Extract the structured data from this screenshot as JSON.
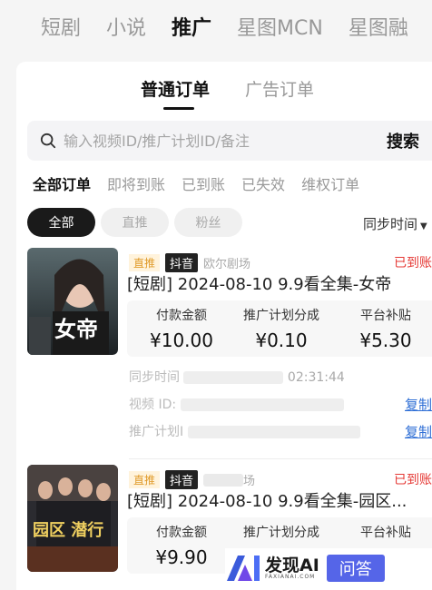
{
  "top_tabs": [
    "短剧",
    "小说",
    "推广",
    "星图MCN",
    "星图融"
  ],
  "top_tab_active": 2,
  "order_type": {
    "tabs": [
      "普通订单",
      "广告订单"
    ],
    "active": 0
  },
  "search": {
    "placeholder": "输入视频ID/推广计划ID/备注",
    "button": "搜索"
  },
  "status_tabs": [
    "全部订单",
    "即将到账",
    "已到账",
    "已失效",
    "维权订单"
  ],
  "status_active": 0,
  "filter_pills": [
    "全部",
    "直推",
    "粉丝"
  ],
  "filter_active": 0,
  "sort_label": "同步时间",
  "orders": [
    {
      "tag_type": "直推",
      "tag_platform": "抖音",
      "source": "欧尔剧场",
      "status": "已到账",
      "title": "[短剧] 2024-08-10 9.9看全集-女帝",
      "stat_labels": [
        "付款金额",
        "推广计划分成",
        "平台补贴"
      ],
      "stat_values": [
        "¥10.00",
        "¥0.10",
        "¥5.30"
      ],
      "sync_label": "同步时间",
      "sync_time_tail": "02:31:44",
      "video_id_label": "视频 ID:",
      "plan_label": "推广计划I",
      "copy_label": "复制",
      "poster_text": "女帝"
    },
    {
      "tag_type": "直推",
      "tag_platform": "抖音",
      "source": "场",
      "status": "已到账",
      "title": "[短剧] 2024-08-10 9.9看全集-园区...",
      "stat_labels": [
        "付款金额",
        "推广计划分成",
        "平台补贴"
      ],
      "stat_values": [
        "¥9.90",
        "",
        ""
      ],
      "poster_text": "园区 潜行"
    }
  ],
  "watermark": {
    "name": "发现AI",
    "sub": "FAXIANAI.COM",
    "button": "问答"
  },
  "colors": {
    "accent_red": "#e53935",
    "link_blue": "#2f6fd6",
    "brand": "#5565e8"
  }
}
